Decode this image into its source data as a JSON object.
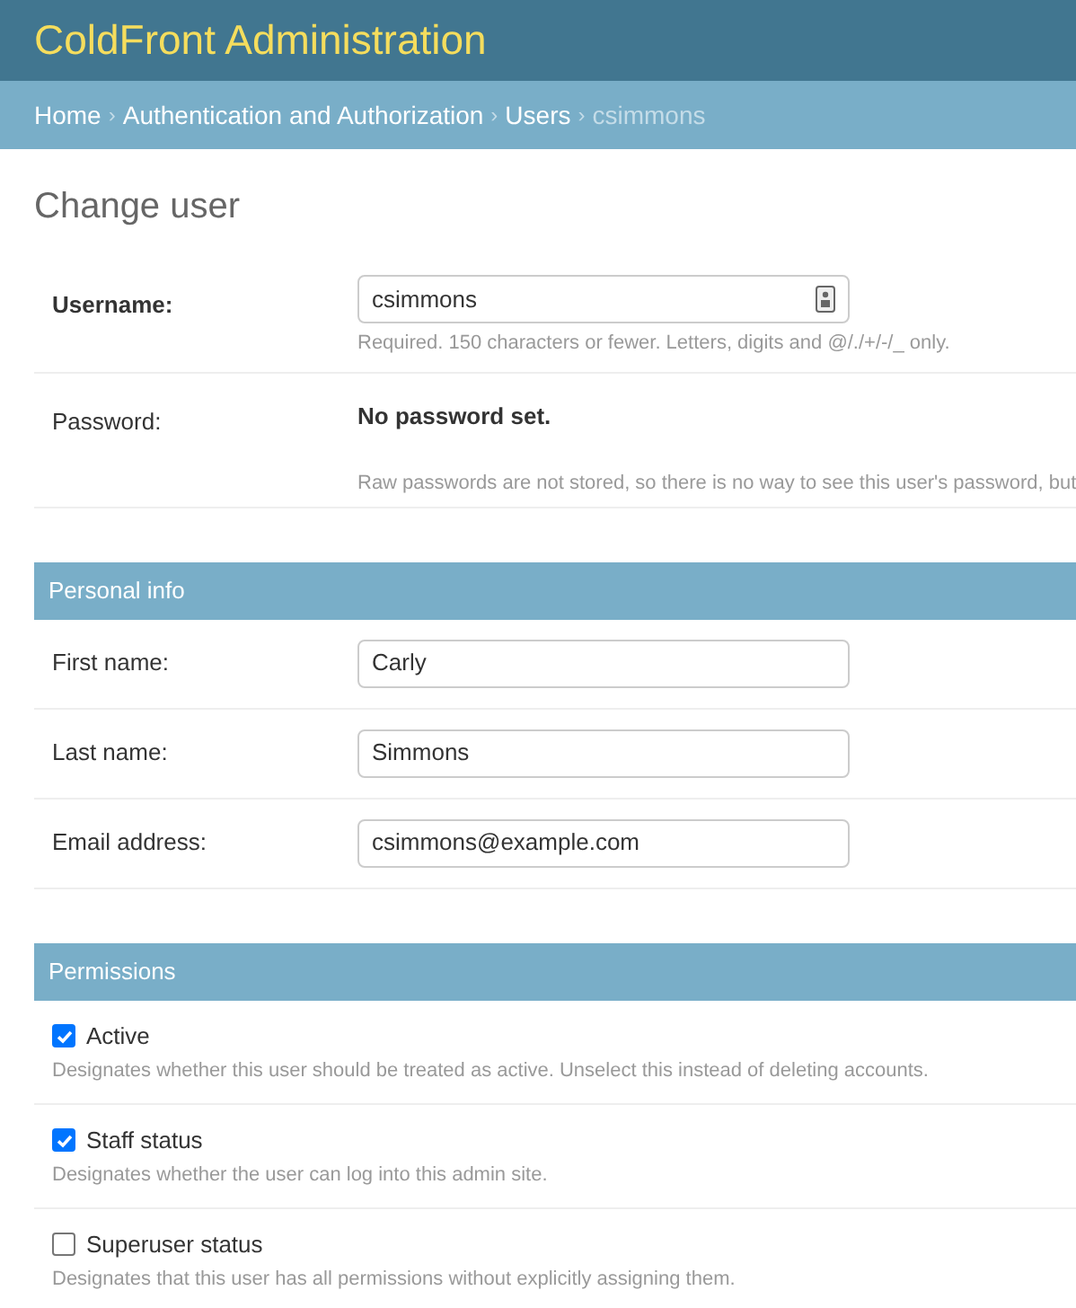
{
  "header": {
    "title": "ColdFront Administration"
  },
  "breadcrumbs": [
    {
      "label": "Home",
      "link": true
    },
    {
      "separator": "›",
      "label": "Authentication and Authorization",
      "link": true
    },
    {
      "separator": "›",
      "label": "Users",
      "link": true
    },
    {
      "separator": "›",
      "label": "csimmons",
      "link": false
    }
  ],
  "page_title": "Change user",
  "account_rows": [
    {
      "kind": "input",
      "label": "Username:",
      "required": true,
      "value": "csimmons",
      "help": "Required. 150 characters or fewer. Letters, digits and @/./+/-/_ only."
    },
    {
      "kind": "readonly",
      "label": "Password:",
      "required": false,
      "value": "No password set.",
      "help": "Raw passwords are not stored, so there is no way to see this user's password, but"
    }
  ],
  "sections": [
    {
      "title": "Personal info",
      "rows": [
        {
          "kind": "input",
          "label": "First name:",
          "value": "Carly"
        },
        {
          "kind": "input",
          "label": "Last name:",
          "value": "Simmons"
        },
        {
          "kind": "input",
          "label": "Email address:",
          "value": "csimmons@example.com"
        }
      ]
    },
    {
      "title": "Permissions",
      "rows": [
        {
          "kind": "checkbox",
          "label": "Active",
          "checked": true,
          "help": "Designates whether this user should be treated as active. Unselect this instead of deleting accounts."
        },
        {
          "kind": "checkbox",
          "label": "Staff status",
          "checked": true,
          "help": "Designates whether the user can log into this admin site."
        },
        {
          "kind": "checkbox",
          "label": "Superuser status",
          "checked": false,
          "help": "Designates that this user has all permissions without explicitly assigning them."
        }
      ]
    }
  ]
}
